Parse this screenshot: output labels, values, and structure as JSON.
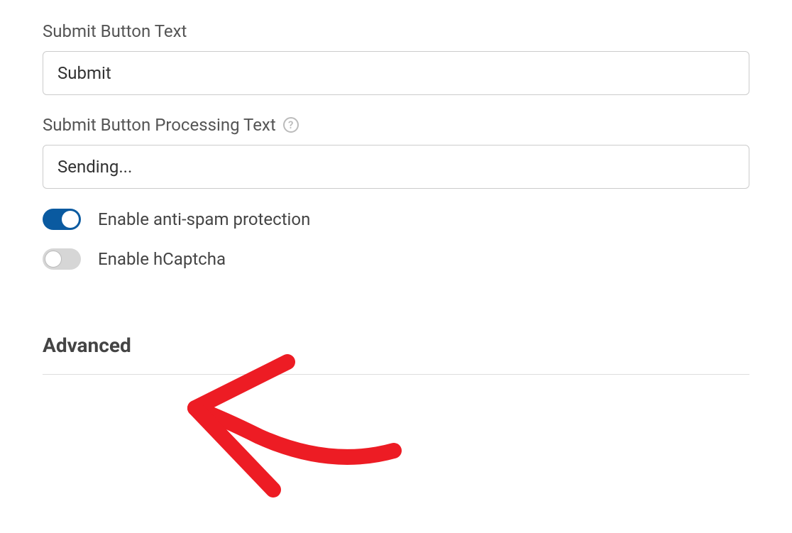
{
  "fields": {
    "submitButtonText": {
      "label": "Submit Button Text",
      "value": "Submit"
    },
    "submitButtonProcessingText": {
      "label": "Submit Button Processing Text",
      "value": "Sending..."
    }
  },
  "toggles": {
    "antiSpam": {
      "label": "Enable anti-spam protection",
      "enabled": true
    },
    "hcaptcha": {
      "label": "Enable hCaptcha",
      "enabled": false
    }
  },
  "sections": {
    "advanced": "Advanced"
  },
  "helpIcon": "?"
}
